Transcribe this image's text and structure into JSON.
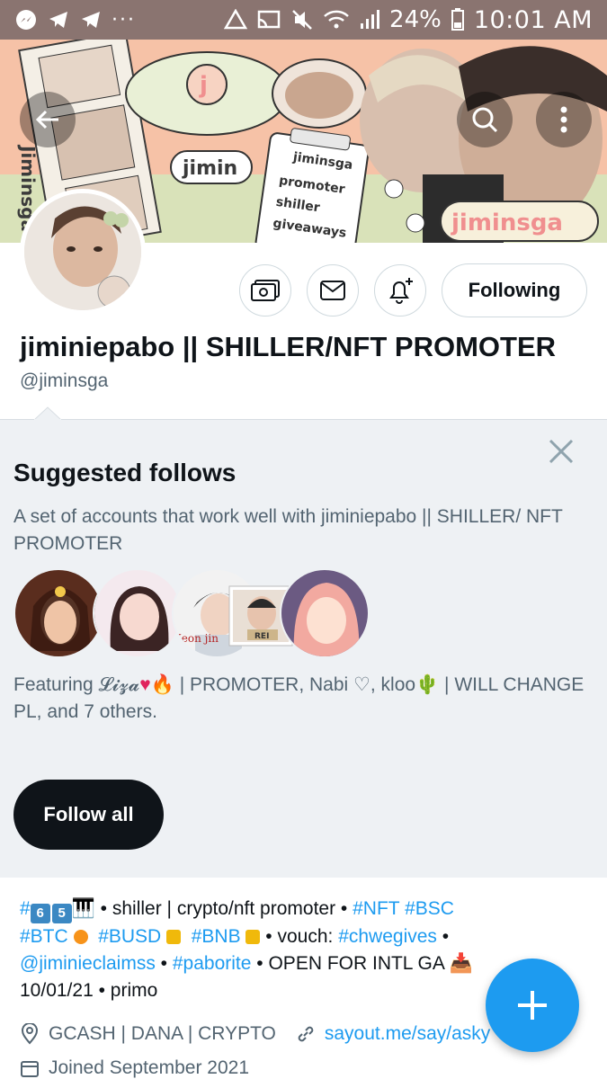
{
  "status_bar": {
    "battery": "24%",
    "time": "10:01 AM"
  },
  "banner": {
    "sticker_jimin": "jimin",
    "sticker_jiminsga": "jiminsga",
    "sticker_side": "Jiminsga",
    "note_title": "jiminsga",
    "note_items": [
      "promoter",
      "shiller",
      "giveaways"
    ]
  },
  "profile": {
    "display_name": "jiminiepabo || SHILLER/NFT PROMOTER",
    "handle": "@jiminsga",
    "following_label": "Following"
  },
  "suggested": {
    "title": "Suggested follows",
    "description": "A set of accounts that work well with jiminiepabo || SHILLER/ NFT PROMOTER",
    "featuring_prefix": "Featuring ",
    "featuring_name1": "𝓛𝓲𝔃𝓪",
    "featuring_rest": " | PROMOTER, Nabi ♡, kloo",
    "featuring_tail": " | WILL CHANGE PL, and 7 others.",
    "follow_all_label": "Follow all",
    "avatar_label_rei": "REI",
    "avatar_label_jeon": "Jeon jin"
  },
  "bio": {
    "hash1": "#",
    "keycap6": "6",
    "keycap5": "5",
    "text1": " • shiller | crypto/nft promoter • ",
    "tag_nft": "#NFT",
    "tag_bsc": "#BSC",
    "tag_btc": "#BTC",
    "tag_busd": "#BUSD",
    "tag_bnb": "#BNB",
    "text_vouch": " • vouch: ",
    "tag_chwegives": "#chwegives",
    "mention": "@jiminieclaimss",
    "tag_paborite": "#paborite",
    "text_open": " • OPEN FOR INTL GA ",
    "text_date": "10/01/21 • primo"
  },
  "meta": {
    "location": "GCASH | DANA | CRYPTO",
    "link": "sayout.me/say/asky",
    "joined": "Joined September 2021"
  },
  "colors": {
    "accent": "#1d9bf0",
    "statusbar": "#8a7470",
    "suggested_bg": "#eef1f4"
  }
}
